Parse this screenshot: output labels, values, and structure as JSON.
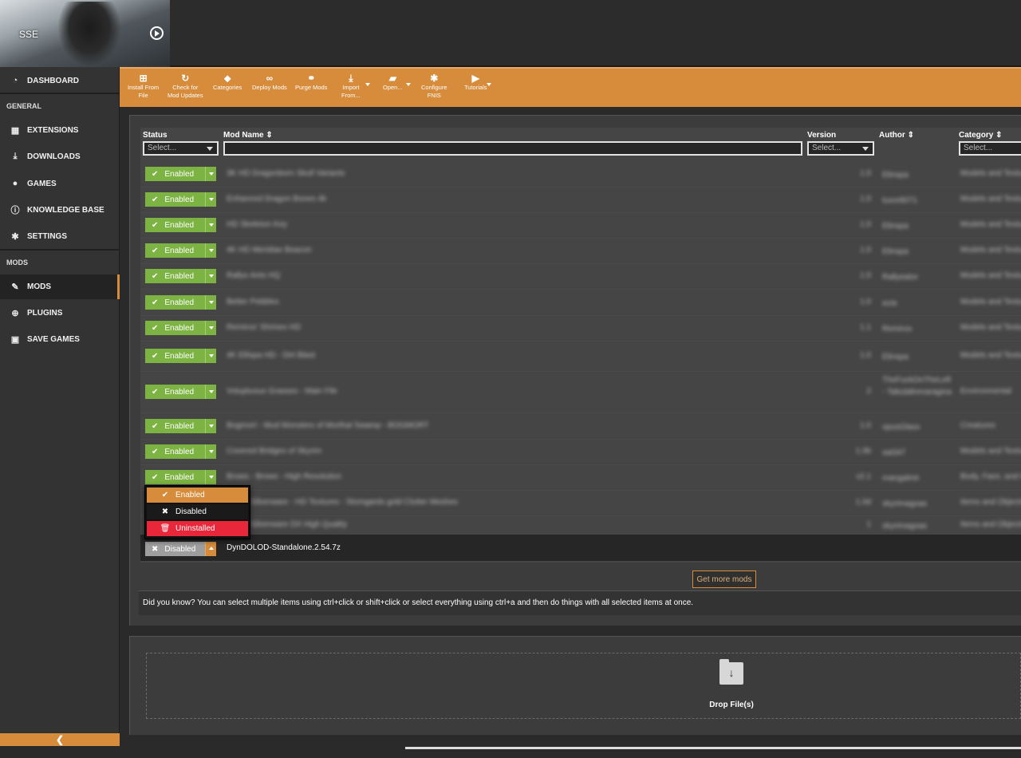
{
  "header": {
    "game_label": "SSE"
  },
  "sidebar": {
    "dashboard": "DASHBOARD",
    "general_section": "GENERAL",
    "extensions": "EXTENSIONS",
    "downloads": "DOWNLOADS",
    "games": "GAMES",
    "knowledge_base": "KNOWLEDGE BASE",
    "settings": "SETTINGS",
    "mods_section": "MODS",
    "mods": "MODS",
    "plugins": "PLUGINS",
    "save_games": "SAVE GAMES",
    "collapse_glyph": "❮"
  },
  "toolbar": {
    "install_from_file": [
      "Install From",
      "File"
    ],
    "check_updates": [
      "Check for",
      "Mod Updates"
    ],
    "categories": "Categories",
    "deploy_mods": "Deploy Mods",
    "purge_mods": "Purge Mods",
    "import_from": [
      "Import",
      "From..."
    ],
    "open": "Open...",
    "configure_fnis": [
      "Configure",
      "FNIS"
    ],
    "tutorials": "Tutorials"
  },
  "table": {
    "headers": {
      "status": "Status",
      "mod_name": "Mod Name",
      "version": "Version",
      "author": "Author",
      "category": "Category"
    },
    "filters": {
      "status": "Select...",
      "version": "Select...",
      "category": "Select..."
    },
    "rows": [
      {
        "status": "Enabled",
        "name": "3K HD Dragonborn Skull Variants",
        "version": "1.0",
        "author": "Elinspa",
        "category": "Models and Textures"
      },
      {
        "status": "Enabled",
        "name": "Enhanced Dragon Bones 4k",
        "version": "1.0",
        "author": "luxor8071",
        "category": "Models and Textures"
      },
      {
        "status": "Enabled",
        "name": "HD Skeleton Key",
        "version": "1.0",
        "author": "Elinspa",
        "category": "Models and Textures"
      },
      {
        "status": "Enabled",
        "name": "4K HD Meridias Beacon",
        "version": "1.0",
        "author": "Elinspa",
        "category": "Models and Textures"
      },
      {
        "status": "Enabled",
        "name": "Rallys Ants HQ",
        "version": "1.0",
        "author": "Rallyeator",
        "category": "Models and Textures"
      },
      {
        "status": "Enabled",
        "name": "Better Pebbles",
        "version": "1.0",
        "author": "ecte",
        "category": "Models and Textures"
      },
      {
        "status": "Enabled",
        "name": "Remiros' Shrines HD",
        "version": "1.1",
        "author": "Remiros",
        "category": "Models and Textures"
      },
      {
        "status": "Enabled",
        "name": "4K Ellispa HD - Dirt Blast",
        "version": "1.0",
        "author": "Elinspa",
        "category": "Models and Textures"
      },
      {
        "status": "Enabled",
        "name": "Voluptuous Grasses - Main File",
        "version": "2",
        "author": "TheFuckOnTheLeft - Tabulalinmaragina",
        "category": "Environmental"
      },
      {
        "status": "Enabled",
        "name": "Bogmort - Mud Monsters of Morthal Swamp - BOGMORT",
        "version": "1.0",
        "author": "opusGlass",
        "category": "Creatures"
      },
      {
        "status": "Enabled",
        "name": "Covered Bridges of Skyrim",
        "version": "1.0b",
        "author": "sai347",
        "category": "Models and Textures"
      },
      {
        "status": "Enabled",
        "name": "Brows - Brows - High Resolution",
        "version": "v2.1",
        "author": "mangalmir",
        "category": "Body, Face, and Hair"
      },
      {
        "status": "Enabled",
        "name": "Rustic Silverware - HD Textures - Stomgards gold Clutter Meshes",
        "version": "1.0d",
        "author": "skyrimagoas",
        "category": "Items and Objects"
      },
      {
        "status": "Enabled",
        "name": "Rustic Silverware DX High Quality",
        "version": "1",
        "author": "skyrimagoas",
        "category": "Items and Objects"
      }
    ],
    "selected_row": {
      "status": "Disabled",
      "name": "DynDOLOD-Standalone.2.54.7z"
    }
  },
  "status_menu": {
    "enabled": "Enabled",
    "disabled": "Disabled",
    "uninstalled": "Uninstalled"
  },
  "footer": {
    "get_more": "Get more mods",
    "tip": "Did you know? You can select multiple items using ctrl+click or shift+click or select everything using ctrl+a and then do things with all selected items at once.",
    "drop_label": "Drop File(s)"
  },
  "colors": {
    "accent": "#d78c3c",
    "enabled": "#7cb342",
    "uninstalled": "#e8273b"
  }
}
